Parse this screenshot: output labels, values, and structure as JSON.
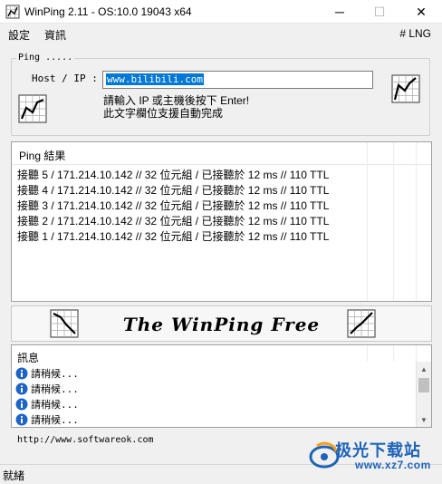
{
  "window": {
    "title": "WinPing 2.11 - OS:10.0 19043 x64",
    "minimize_glyph": "─",
    "maximize_glyph": "☐",
    "close_glyph": "✕"
  },
  "menu": {
    "settings": "設定",
    "info": "資訊",
    "language": "# LNG"
  },
  "ping": {
    "group_label": "Ping .....",
    "host_label": "Host / IP :",
    "host_value": "www.bilibili.com",
    "hint_line1": "請輸入 IP 或主機後按下 Enter!",
    "hint_line2": "此文字欄位支援自動完成"
  },
  "results": {
    "title": "Ping 結果",
    "rows": [
      "接聽 5 / 171.214.10.142 // 32 位元組 / 已接聽於 12 ms // 110 TTL",
      "接聽 4 / 171.214.10.142 // 32 位元組 / 已接聽於 12 ms // 110 TTL",
      "接聽 3 / 171.214.10.142 // 32 位元組 / 已接聽於 12 ms // 110 TTL",
      "接聽 2 / 171.214.10.142 // 32 位元組 / 已接聽於 12 ms // 110 TTL",
      "接聽 1 / 171.214.10.142 // 32 位元組 / 已接聽於 12 ms // 110 TTL"
    ]
  },
  "banner": {
    "text": "The WinPing Free"
  },
  "messages": {
    "title": "訊息",
    "rows": [
      "請稍候...",
      "請稍候...",
      "請稍候...",
      "請稍候..."
    ],
    "icon": "info-icon"
  },
  "footer": {
    "url": "http://www.softwareok.com",
    "status": "就緒"
  },
  "watermark": {
    "title": "极光下载站",
    "url": "www.xz7.com"
  },
  "colors": {
    "selection": "#0078d7",
    "info_icon": "#1c64c8",
    "watermark": "#1e63b8"
  }
}
